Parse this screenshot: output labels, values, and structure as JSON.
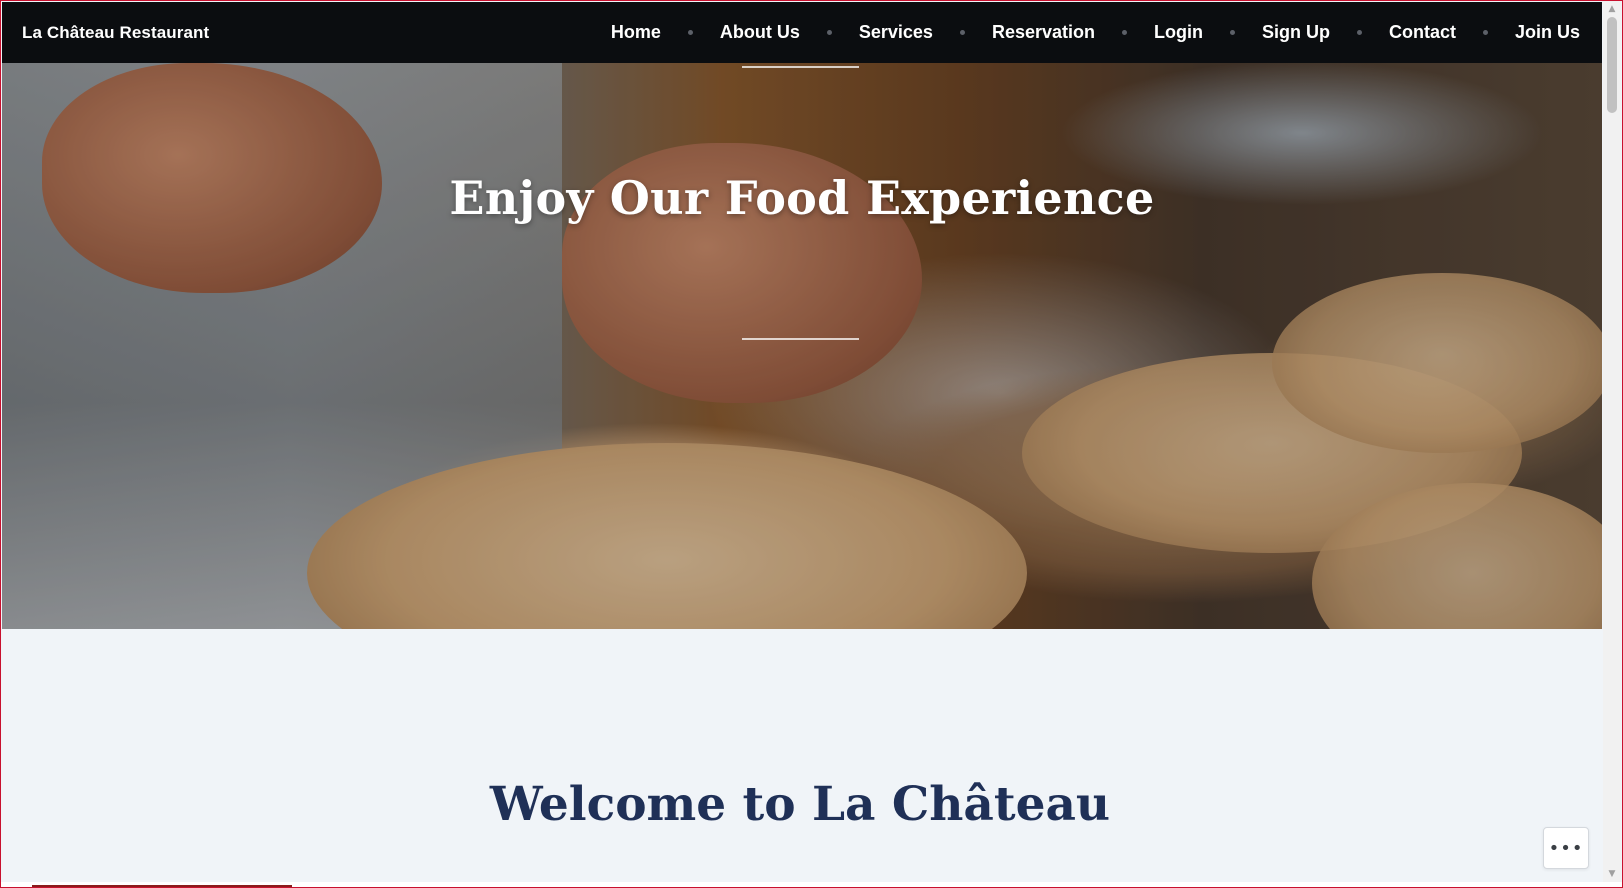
{
  "navbar": {
    "brand": "La Château Restaurant",
    "items": [
      {
        "label": "Home"
      },
      {
        "label": "About Us"
      },
      {
        "label": "Services"
      },
      {
        "label": "Reservation"
      },
      {
        "label": "Login"
      },
      {
        "label": "Sign Up"
      },
      {
        "label": "Contact"
      },
      {
        "label": "Join Us"
      }
    ]
  },
  "hero": {
    "title": "Enjoy Our Food Experience"
  },
  "welcome": {
    "heading": "Welcome to La Château"
  },
  "more_button": {
    "icon": "ellipsis-icon",
    "glyph": "•••"
  },
  "scrollbar": {
    "up_glyph": "▲",
    "down_glyph": "▼"
  },
  "colors": {
    "navbar_bg": "#0b0d10",
    "page_bg": "#f0f4f8",
    "heading_color": "#1f3057",
    "frame_border": "#c8102e"
  }
}
